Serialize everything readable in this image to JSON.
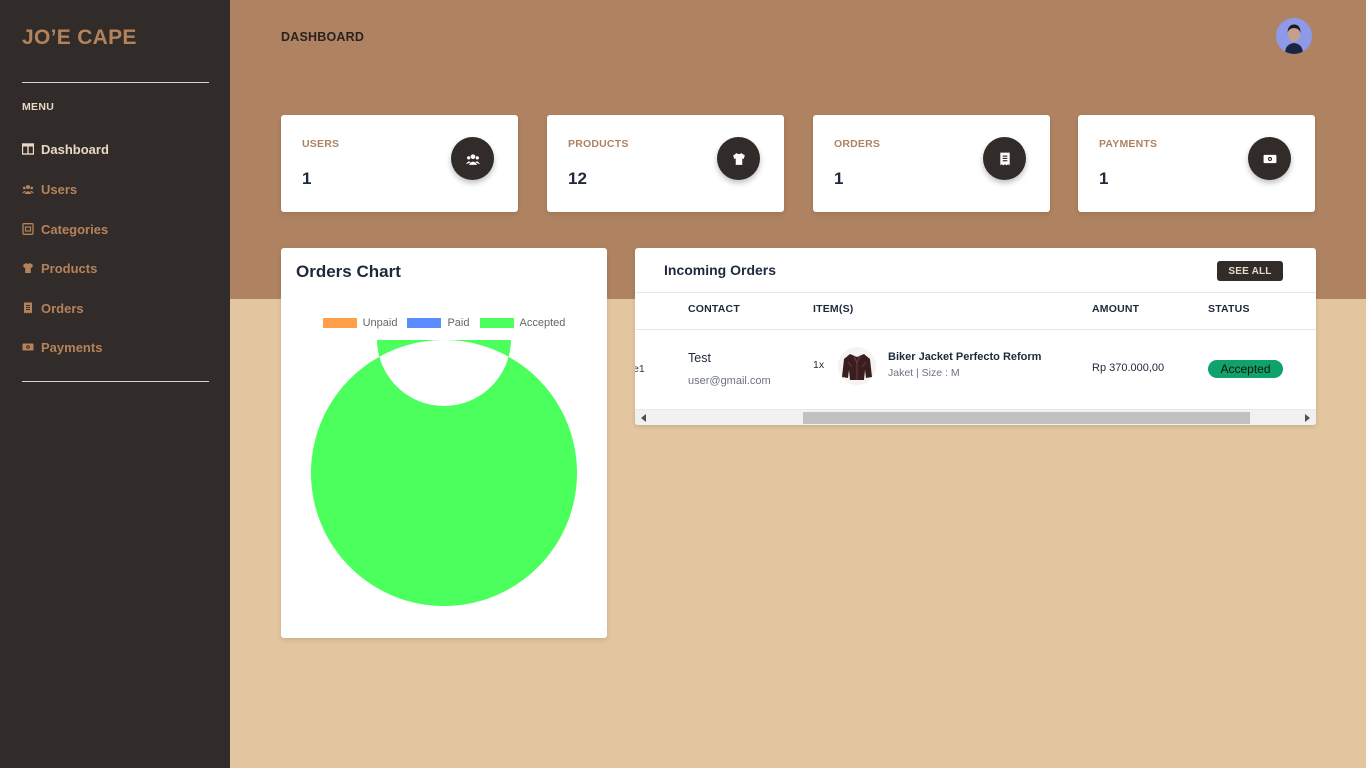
{
  "app": {
    "brand": "JO’E CAPE"
  },
  "sidebar": {
    "menu_title": "MENU",
    "items": [
      {
        "label": "Dashboard",
        "icon": "table-columns-icon",
        "active": true
      },
      {
        "label": "Users",
        "icon": "users-icon",
        "active": false
      },
      {
        "label": "Categories",
        "icon": "category-list-icon",
        "active": false
      },
      {
        "label": "Products",
        "icon": "tshirt-icon",
        "active": false
      },
      {
        "label": "Orders",
        "icon": "receipt-icon",
        "active": false
      },
      {
        "label": "Payments",
        "icon": "money-bill-icon",
        "active": false
      }
    ]
  },
  "header": {
    "title": "DASHBOARD",
    "avatar": "user-avatar"
  },
  "stats": [
    {
      "label": "USERS",
      "value": "1",
      "icon": "users-icon"
    },
    {
      "label": "PRODUCTS",
      "value": "12",
      "icon": "tshirt-icon"
    },
    {
      "label": "ORDERS",
      "value": "1",
      "icon": "receipt-icon"
    },
    {
      "label": "PAYMENTS",
      "value": "1",
      "icon": "money-bill-icon"
    }
  ],
  "orders_chart": {
    "title": "Orders Chart"
  },
  "chart_data": {
    "type": "pie",
    "title": "Orders Chart",
    "categories": [
      "Unpaid",
      "Paid",
      "Accepted"
    ],
    "values": [
      0,
      0,
      1
    ],
    "colors": [
      "#ff9f4a",
      "#5b8cff",
      "#4bff5c"
    ],
    "legend": "top"
  },
  "incoming_orders": {
    "title": "Incoming Orders",
    "see_all_label": "SEE ALL",
    "columns": [
      "CONTACT",
      "ITEM(S)",
      "AMOUNT",
      "STATUS"
    ],
    "rows": [
      {
        "truncated_id": "e1",
        "contact_name": "Test",
        "contact_email": "user@gmail.com",
        "qty": "1x",
        "item_name": "Biker Jacket Perfecto Reform",
        "item_variant": "Jaket | Size : M",
        "amount": "Rp 370.000,00",
        "status": "Accepted"
      }
    ]
  },
  "colors": {
    "sidebar_bg": "#312b2a",
    "brand": "#af8361",
    "page_bg": "#e3c69f",
    "status_accepted": "#10a26b"
  }
}
